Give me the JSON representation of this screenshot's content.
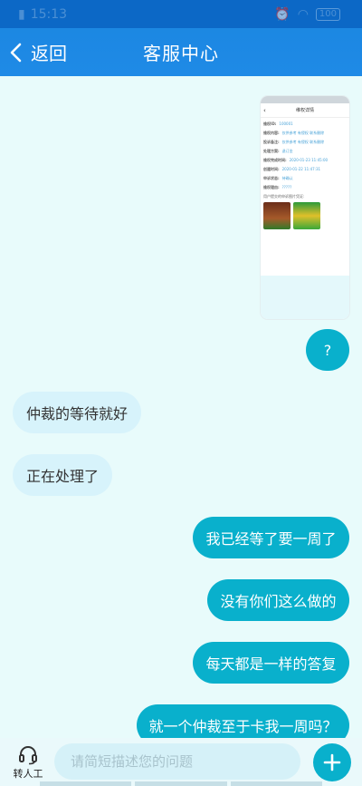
{
  "status_bar": {
    "time": "15:13",
    "battery": "100"
  },
  "header": {
    "back_label": "返回",
    "title": "客服中心"
  },
  "attachment": {
    "title": "维权详情",
    "rows": [
      {
        "label": "维权ID:",
        "value": "100001"
      },
      {
        "label": "维权内容:",
        "value": "仅供参考 有侵权 联系删除"
      },
      {
        "label": "投诉备注:",
        "value": "仅供参考 有侵权 联系删除"
      },
      {
        "label": "处理方案:",
        "value": "退订金"
      },
      {
        "label": "维权完成时间:",
        "value": "2020-01-23 11:45:00"
      },
      {
        "label": "创建时间:",
        "value": "2020-01-22 11:47:31"
      },
      {
        "label": "申诉状态:",
        "value": "待确认"
      },
      {
        "label": "维权理由:",
        "value": "?????"
      }
    ],
    "images_label": "用户提交的申诉图片凭证:"
  },
  "messages": [
    {
      "side": "right",
      "text": "?"
    },
    {
      "side": "left",
      "text": "仲裁的等待就好"
    },
    {
      "side": "left",
      "text": "正在处理了"
    },
    {
      "side": "right",
      "text": "我已经等了要一周了"
    },
    {
      "side": "right",
      "text": "没有你们这么做的"
    },
    {
      "side": "right",
      "text": "每天都是一样的答复"
    },
    {
      "side": "right",
      "text": "就一个仲裁至于卡我一周吗？"
    }
  ],
  "bottom_bar": {
    "agent_label": "转人工",
    "input_placeholder": "请简短描述您的问题",
    "input_value": ""
  },
  "colors": {
    "header": "#1f8ae6",
    "background": "#e8fbfb",
    "bubble_right": "#09b0cc",
    "bubble_left": "#d7f3fb"
  }
}
